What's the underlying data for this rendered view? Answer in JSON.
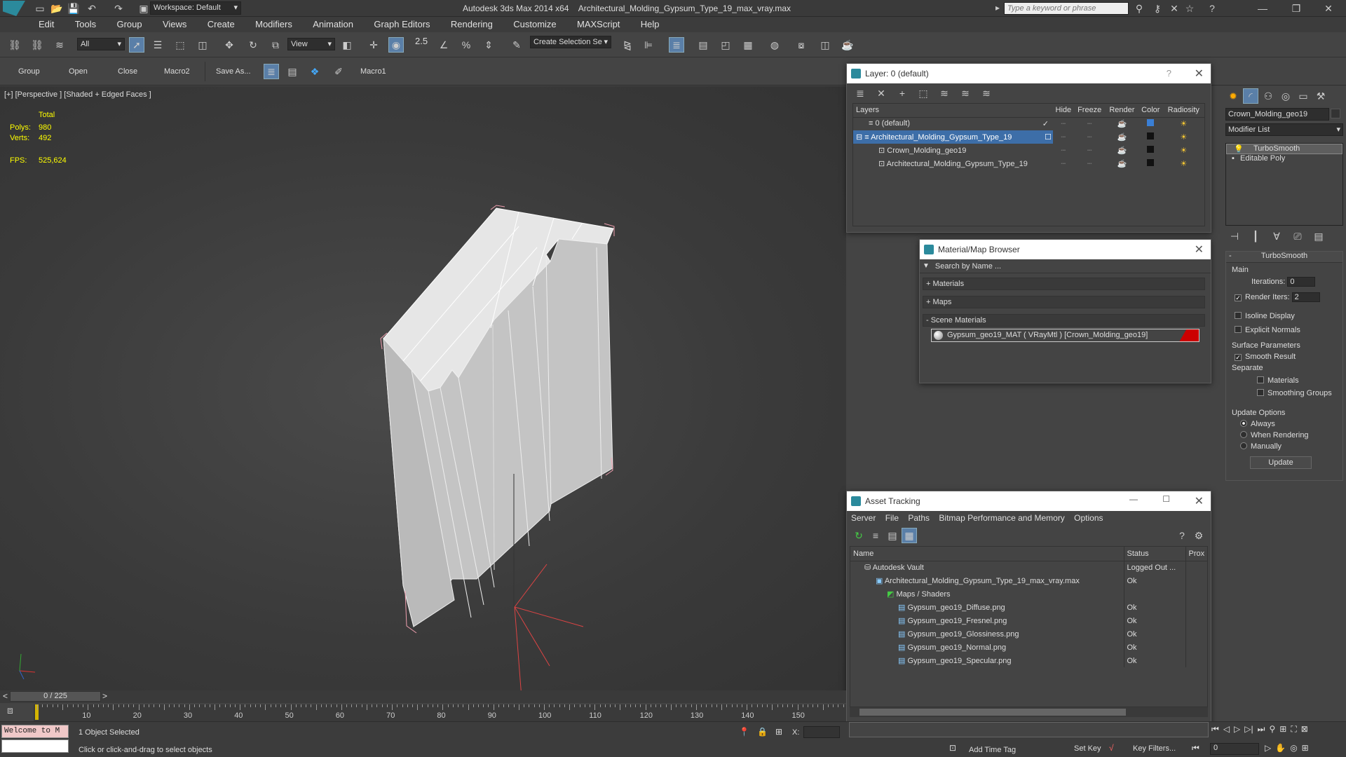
{
  "titlebar": {
    "workspace": "Workspace: Default",
    "app": "Autodesk 3ds Max  2014 x64",
    "file": "Architectural_Molding_Gypsum_Type_19_max_vray.max",
    "search_placeholder": "Type a keyword or phrase"
  },
  "menu": [
    "Edit",
    "Tools",
    "Group",
    "Views",
    "Create",
    "Modifiers",
    "Animation",
    "Graph Editors",
    "Rendering",
    "Customize",
    "MAXScript",
    "Help"
  ],
  "toolbar": {
    "filter": "All",
    "refcoord": "View",
    "snap": "2.5",
    "selection_set": "Create Selection Se"
  },
  "toolbar2": {
    "items": [
      "Group",
      "Open",
      "Close",
      "Macro2",
      "Save As...",
      "Macro1"
    ]
  },
  "viewport": {
    "label": "[+] [Perspective ] [Shaded + Edged Faces ]",
    "stats_header": "Total",
    "polys_label": "Polys:",
    "polys_value": "980",
    "verts_label": "Verts:",
    "verts_value": "492",
    "fps_label": "FPS:",
    "fps_value": "525,624"
  },
  "layers": {
    "title": "Layer: 0 (default)",
    "headers": [
      "Layers",
      "Hide",
      "Freeze",
      "Render",
      "Color",
      "Radiosity"
    ],
    "rows": [
      {
        "name": "0 (default)",
        "color": "#3a7fd5"
      },
      {
        "name": "Architectural_Molding_Gypsum_Type_19",
        "color": "#111111"
      },
      {
        "name": "Crown_Molding_geo19",
        "color": "#111111"
      },
      {
        "name": "Architectural_Molding_Gypsum_Type_19",
        "color": "#111111"
      }
    ]
  },
  "matbrowser": {
    "title": "Material/Map Browser",
    "search": "Search by Name ...",
    "materials": "+ Materials",
    "maps": "+ Maps",
    "scene": "- Scene Materials",
    "item": "Gypsum_geo19_MAT ( VRayMtl ) [Crown_Molding_geo19]"
  },
  "assets": {
    "title": "Asset Tracking",
    "menu": [
      "Server",
      "File",
      "Paths",
      "Bitmap Performance and Memory",
      "Options"
    ],
    "headers": [
      "Name",
      "Status",
      "Prox"
    ],
    "rows": [
      {
        "name": "Autodesk Vault",
        "status": "Logged Out ..."
      },
      {
        "name": "Architectural_Molding_Gypsum_Type_19_max_vray.max",
        "status": "Ok"
      },
      {
        "name": "Maps / Shaders",
        "status": ""
      },
      {
        "name": "Gypsum_geo19_Diffuse.png",
        "status": "Ok"
      },
      {
        "name": "Gypsum_geo19_Fresnel.png",
        "status": "Ok"
      },
      {
        "name": "Gypsum_geo19_Glossiness.png",
        "status": "Ok"
      },
      {
        "name": "Gypsum_geo19_Normal.png",
        "status": "Ok"
      },
      {
        "name": "Gypsum_geo19_Specular.png",
        "status": "Ok"
      }
    ]
  },
  "cmd": {
    "object": "Crown_Molding_geo19",
    "modlist": "Modifier List",
    "stack": [
      "TurboSmooth",
      "Editable Poly"
    ],
    "rollout": "TurboSmooth",
    "main": "Main",
    "iterations_label": "Iterations:",
    "iterations": "0",
    "render_iters_label": "Render Iters:",
    "render_iters": "2",
    "isoline": "Isoline Display",
    "explicit": "Explicit Normals",
    "surface": "Surface Parameters",
    "smooth": "Smooth Result",
    "separate": "Separate",
    "materials": "Materials",
    "smoothing": "Smoothing Groups",
    "update_opts": "Update Options",
    "always": "Always",
    "when_render": "When Rendering",
    "manually": "Manually",
    "update": "Update"
  },
  "timeline": {
    "frame": "0 / 225",
    "ticks": [
      "10",
      "20",
      "30",
      "40",
      "50",
      "60",
      "70",
      "80",
      "90",
      "100",
      "110",
      "120",
      "130",
      "140",
      "150"
    ]
  },
  "status": {
    "welcome": "Welcome to M",
    "selected": "1 Object Selected",
    "prompt": "Click or click-and-drag to select objects",
    "x_label": "X:",
    "add_time_tag": "Add Time Tag",
    "set_key": "Set Key",
    "key_filters": "Key Filters...",
    "frame": "0"
  }
}
